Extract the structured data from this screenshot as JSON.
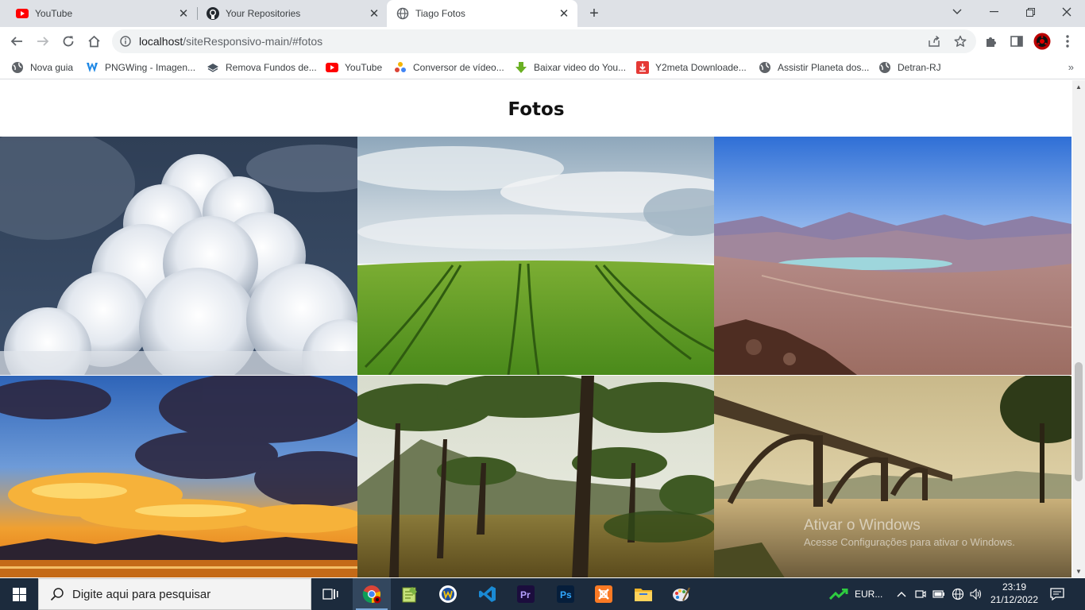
{
  "tabs": [
    {
      "title": "YouTube",
      "icon": "youtube-icon"
    },
    {
      "title": "Your Repositories",
      "icon": "github-icon"
    },
    {
      "title": "Tiago Fotos",
      "icon": "globe-icon",
      "active": true
    }
  ],
  "toolbar": {
    "url_host": "localhost",
    "url_path": "/siteResponsivo-main/#fotos"
  },
  "bookmarks": [
    {
      "label": "Nova guia",
      "icon": "globe-icon"
    },
    {
      "label": "PNGWing - Imagen...",
      "icon": "pngwing-icon"
    },
    {
      "label": "Remova Fundos de...",
      "icon": "layers-icon"
    },
    {
      "label": "YouTube",
      "icon": "youtube-icon"
    },
    {
      "label": "Conversor de vídeo...",
      "icon": "dots-icon"
    },
    {
      "label": "Baixar video do You...",
      "icon": "download-green-icon"
    },
    {
      "label": "Y2meta Downloade...",
      "icon": "download-red-icon"
    },
    {
      "label": "Assistir Planeta dos...",
      "icon": "globe-icon"
    },
    {
      "label": "Detran-RJ",
      "icon": "globe-icon"
    }
  ],
  "page": {
    "title": "Fotos",
    "photos": [
      {
        "subject": "clouds"
      },
      {
        "subject": "green-field"
      },
      {
        "subject": "desert-mountains"
      },
      {
        "subject": "sunset-clouds"
      },
      {
        "subject": "pine-forest"
      },
      {
        "subject": "bridge-lake"
      }
    ]
  },
  "watermark": {
    "line1": "Ativar o Windows",
    "line2": "Acesse Configurações para ativar o Windows."
  },
  "taskbar": {
    "search_placeholder": "Digite aqui para pesquisar",
    "currency": "EUR...",
    "time": "23:19",
    "date": "21/12/2022"
  },
  "colors": {
    "tabstrip": "#dee1e6",
    "taskbar": "#1c2b3d"
  }
}
